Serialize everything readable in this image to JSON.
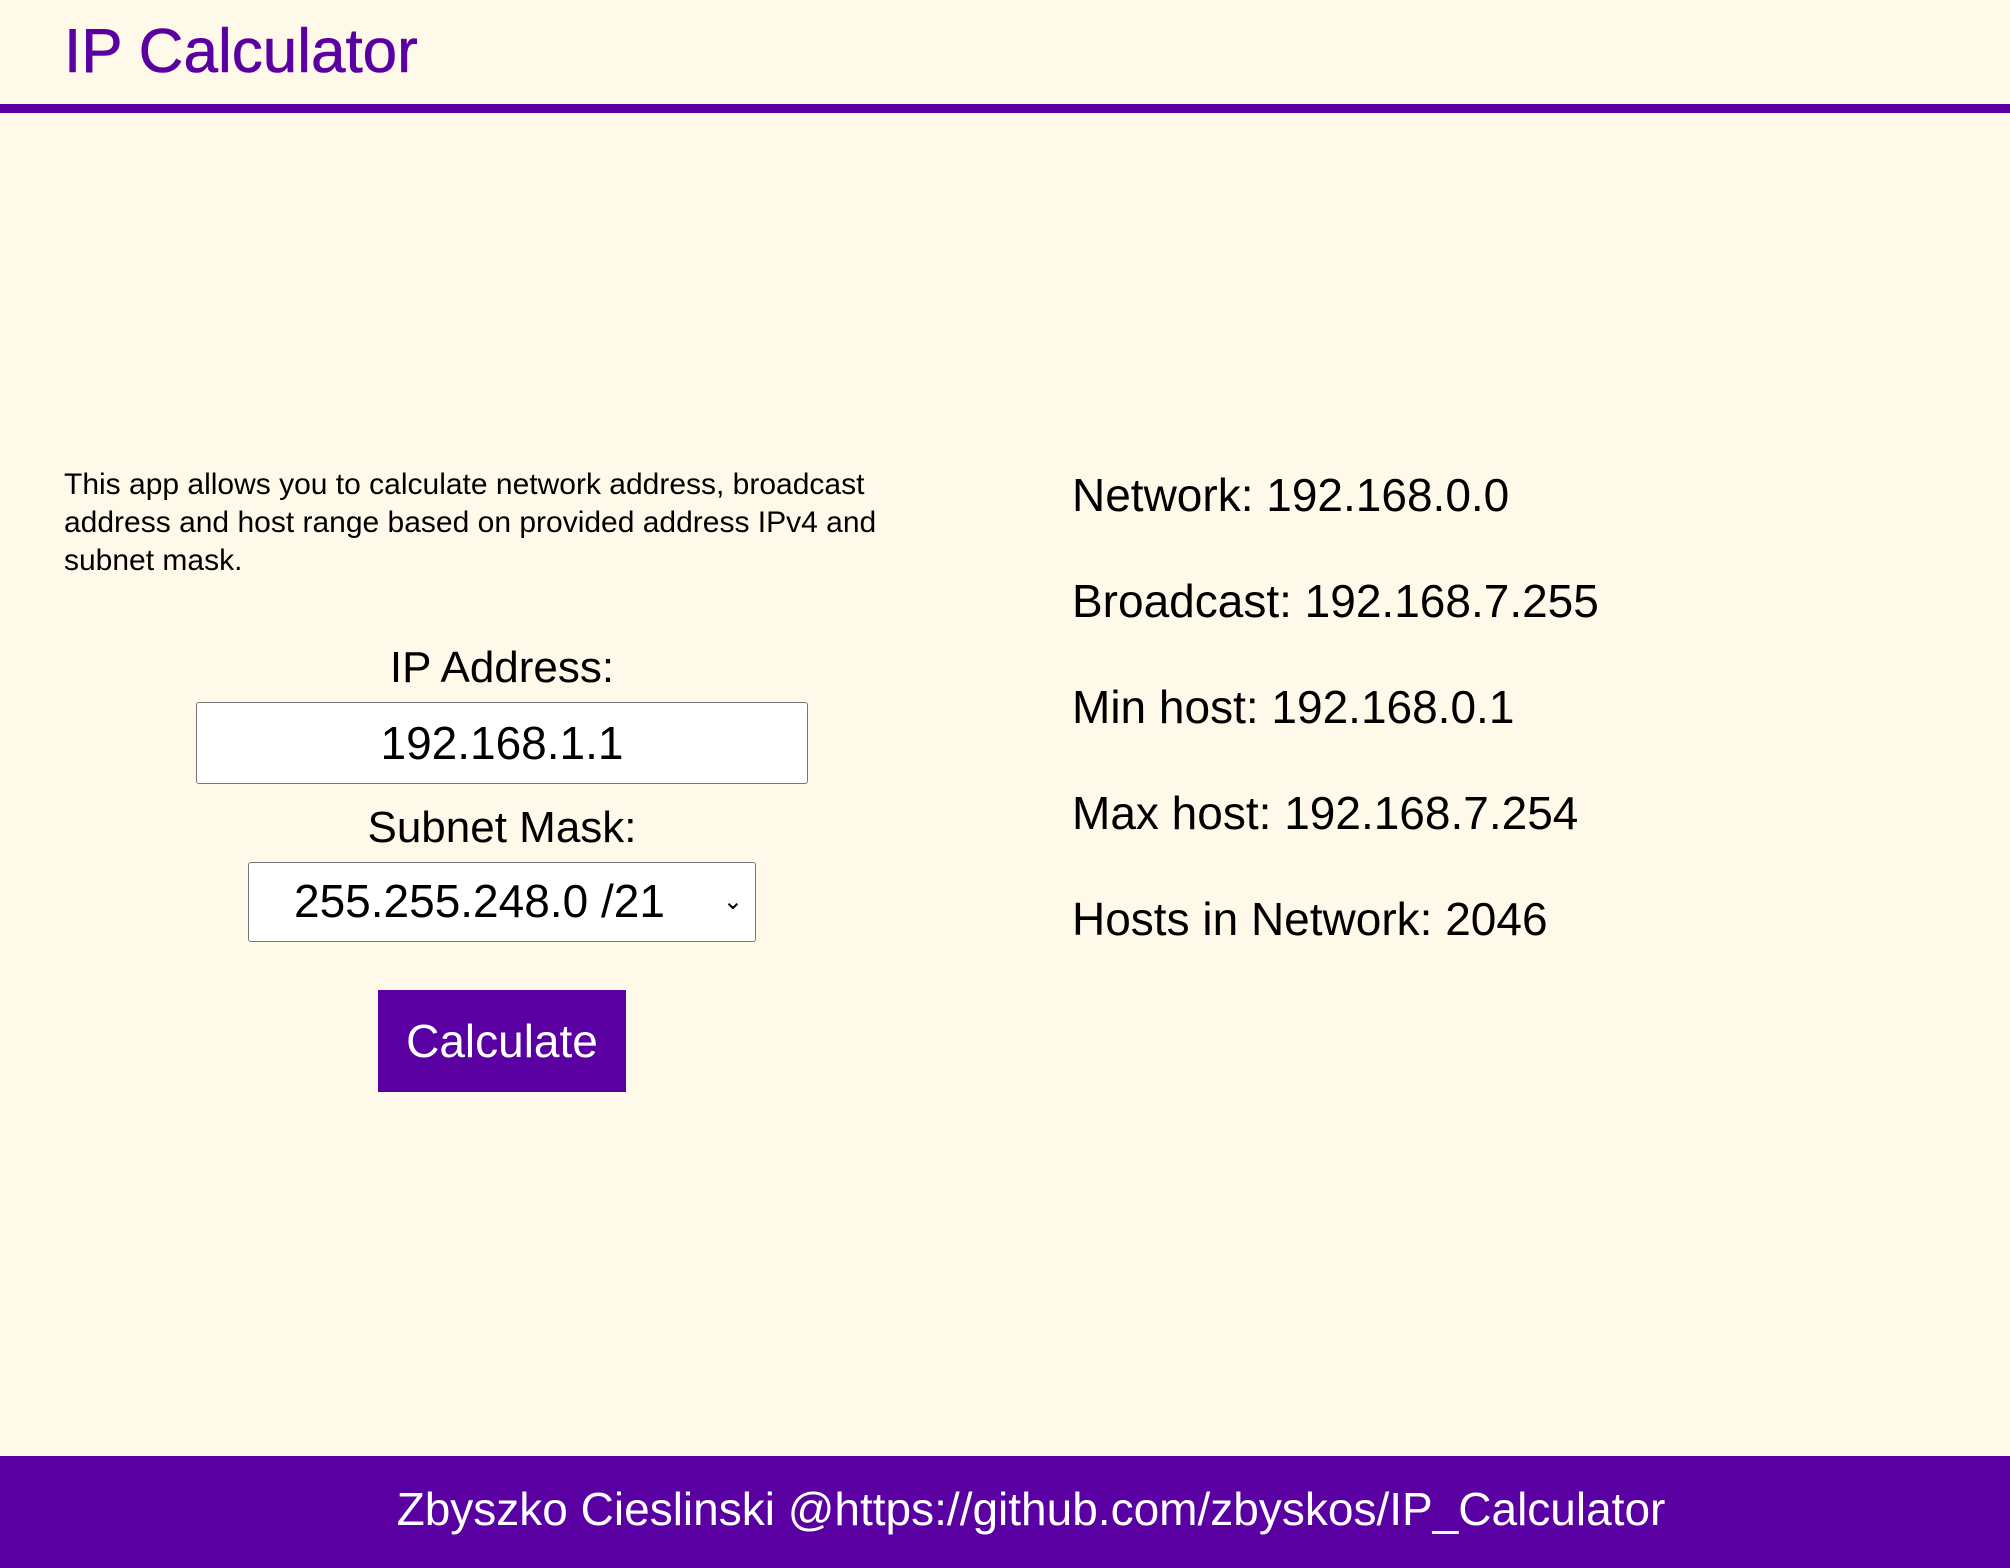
{
  "header": {
    "title": "IP Calculator"
  },
  "description": "This app allows you to calculate network address, broadcast address and host range based on provided address IPv4 and subnet mask.",
  "form": {
    "ip_label": "IP Address:",
    "ip_value": "192.168.1.1",
    "mask_label": "Subnet Mask:",
    "mask_selected": "255.255.248.0 /21",
    "calculate_label": "Calculate"
  },
  "results": {
    "network": "Network: 192.168.0.0",
    "broadcast": "Broadcast: 192.168.7.255",
    "min_host": "Min host: 192.168.0.1",
    "max_host": "Max host: 192.168.7.254",
    "hosts_count": "Hosts in Network: 2046"
  },
  "footer": {
    "text": "Zbyszko Cieslinski @https://github.com/zbyskos/IP_Calculator"
  },
  "colors": {
    "accent": "#5a00a3",
    "background": "#fff9ea",
    "footer_text": "#ffffff"
  },
  "icons": {
    "dropdown": "chevron-down-icon"
  }
}
